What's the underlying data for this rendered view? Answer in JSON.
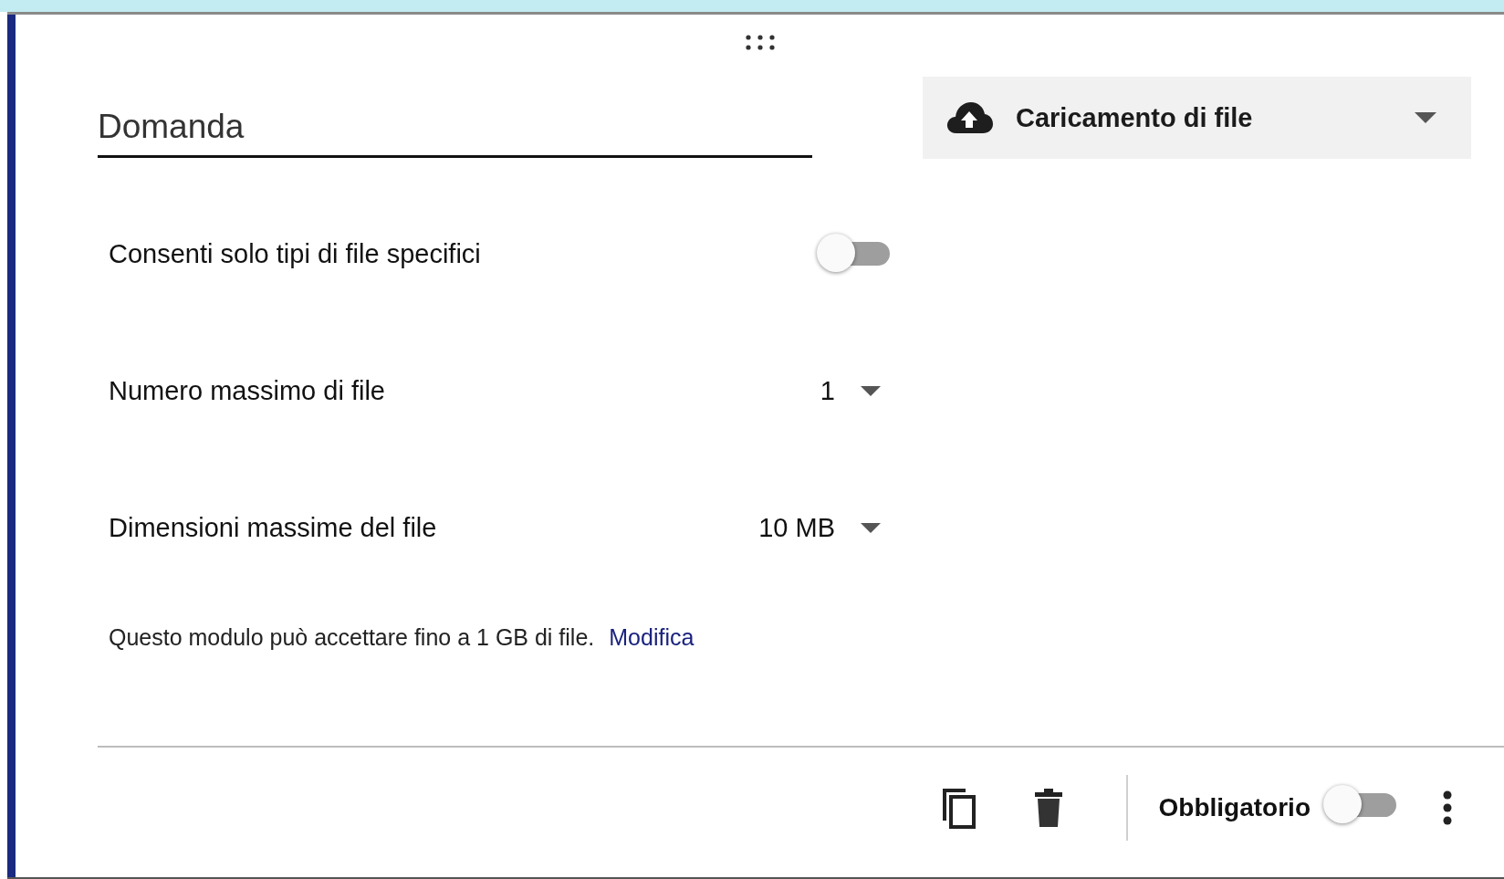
{
  "question": {
    "placeholder": "Domanda"
  },
  "type_select": {
    "value": "Caricamento di file"
  },
  "settings": [
    {
      "kind": "toggle",
      "label": "Consenti solo tipi di file specifici",
      "on": false
    },
    {
      "kind": "select",
      "label": "Numero massimo di file",
      "value": "1"
    },
    {
      "kind": "select",
      "label": "Dimensioni massime del file",
      "value": "10 MB"
    }
  ],
  "note": {
    "text": "Questo modulo può accettare fino a 1 GB di file.",
    "link": "Modifica"
  },
  "footer": {
    "required_label": "Obbligatorio",
    "required": false
  }
}
